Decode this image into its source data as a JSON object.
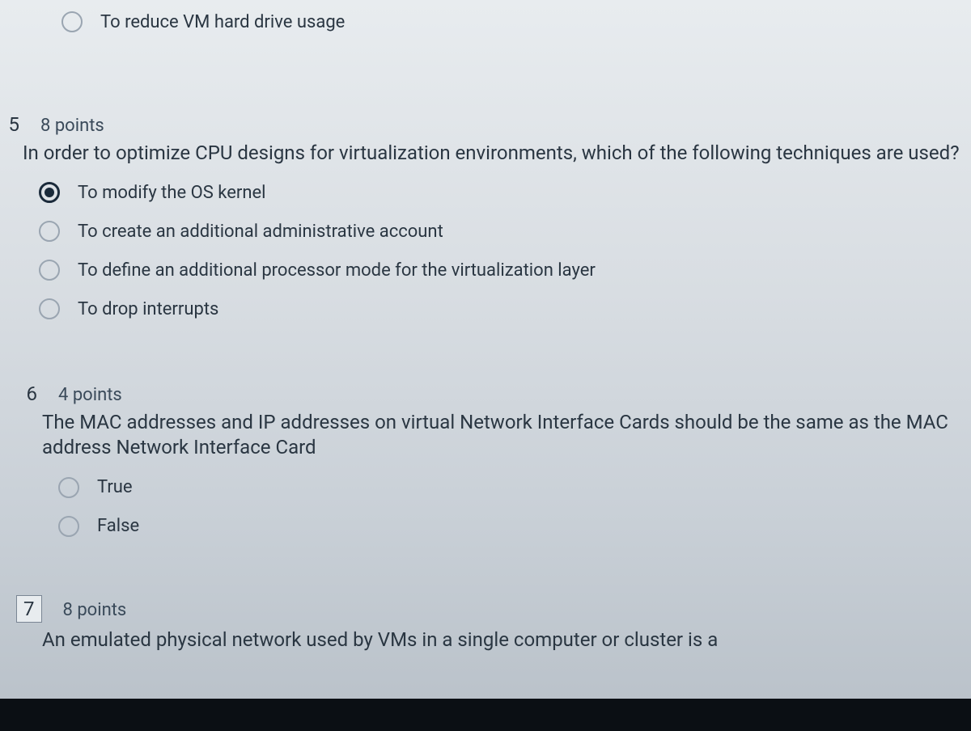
{
  "orphan_option": {
    "label": "To reduce VM hard drive usage",
    "selected": false
  },
  "questions": [
    {
      "number": "5",
      "points": "8 points",
      "text": "In order to optimize CPU designs for virtualization environments, which of the following techniques are used?",
      "options": [
        {
          "label": "To modify the OS kernel",
          "selected": true
        },
        {
          "label": "To create an additional administrative account",
          "selected": false
        },
        {
          "label": "To define an additional processor mode for the virtualization layer",
          "selected": false
        },
        {
          "label": "To drop interrupts",
          "selected": false
        }
      ]
    },
    {
      "number": "6",
      "points": "4 points",
      "text": "The MAC addresses and IP addresses on virtual Network Interface Cards should be the same as the MAC address Network Interface Card",
      "options": [
        {
          "label": "True",
          "selected": false
        },
        {
          "label": "False",
          "selected": false
        }
      ]
    },
    {
      "number": "7",
      "points": "8 points",
      "text": "An emulated physical network used by VMs in a single computer or cluster is a",
      "options": []
    }
  ]
}
